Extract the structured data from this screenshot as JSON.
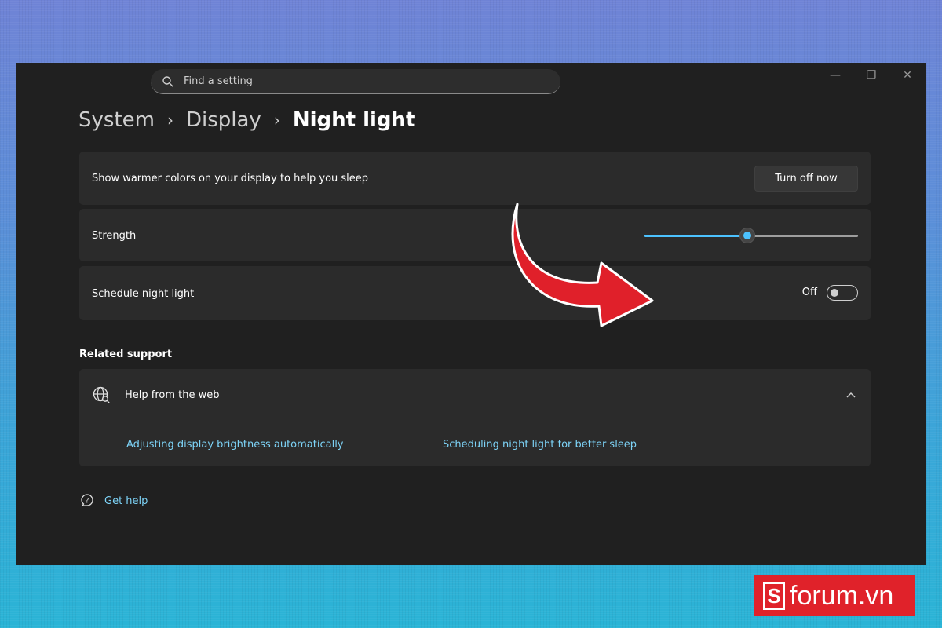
{
  "search": {
    "placeholder": "Find a setting"
  },
  "window_controls": {
    "minimize": "—",
    "restore": "❐",
    "close": "✕"
  },
  "breadcrumb": {
    "items": [
      "System",
      "Display",
      "Night light"
    ],
    "separator": "›"
  },
  "night_light": {
    "turn_off_text": "Show warmer colors on your display to help you sleep",
    "turn_off_button": "Turn off now",
    "strength_label": "Strength",
    "strength_value": 0.48,
    "schedule_label": "Schedule night light",
    "schedule_state": "Off"
  },
  "related_support": {
    "title": "Related support",
    "help_title": "Help from the web",
    "links": [
      "Adjusting display brightness automatically",
      "Scheduling night light for better sleep"
    ]
  },
  "get_help": {
    "label": "Get help"
  },
  "watermark": {
    "brand": "forum.vn",
    "brand_letter": "S"
  },
  "colors": {
    "accent": "#4cc2ff",
    "window_bg": "#202020",
    "card_bg": "#2b2b2b",
    "arrow": "#e0202a",
    "brand": "#e0222a"
  }
}
